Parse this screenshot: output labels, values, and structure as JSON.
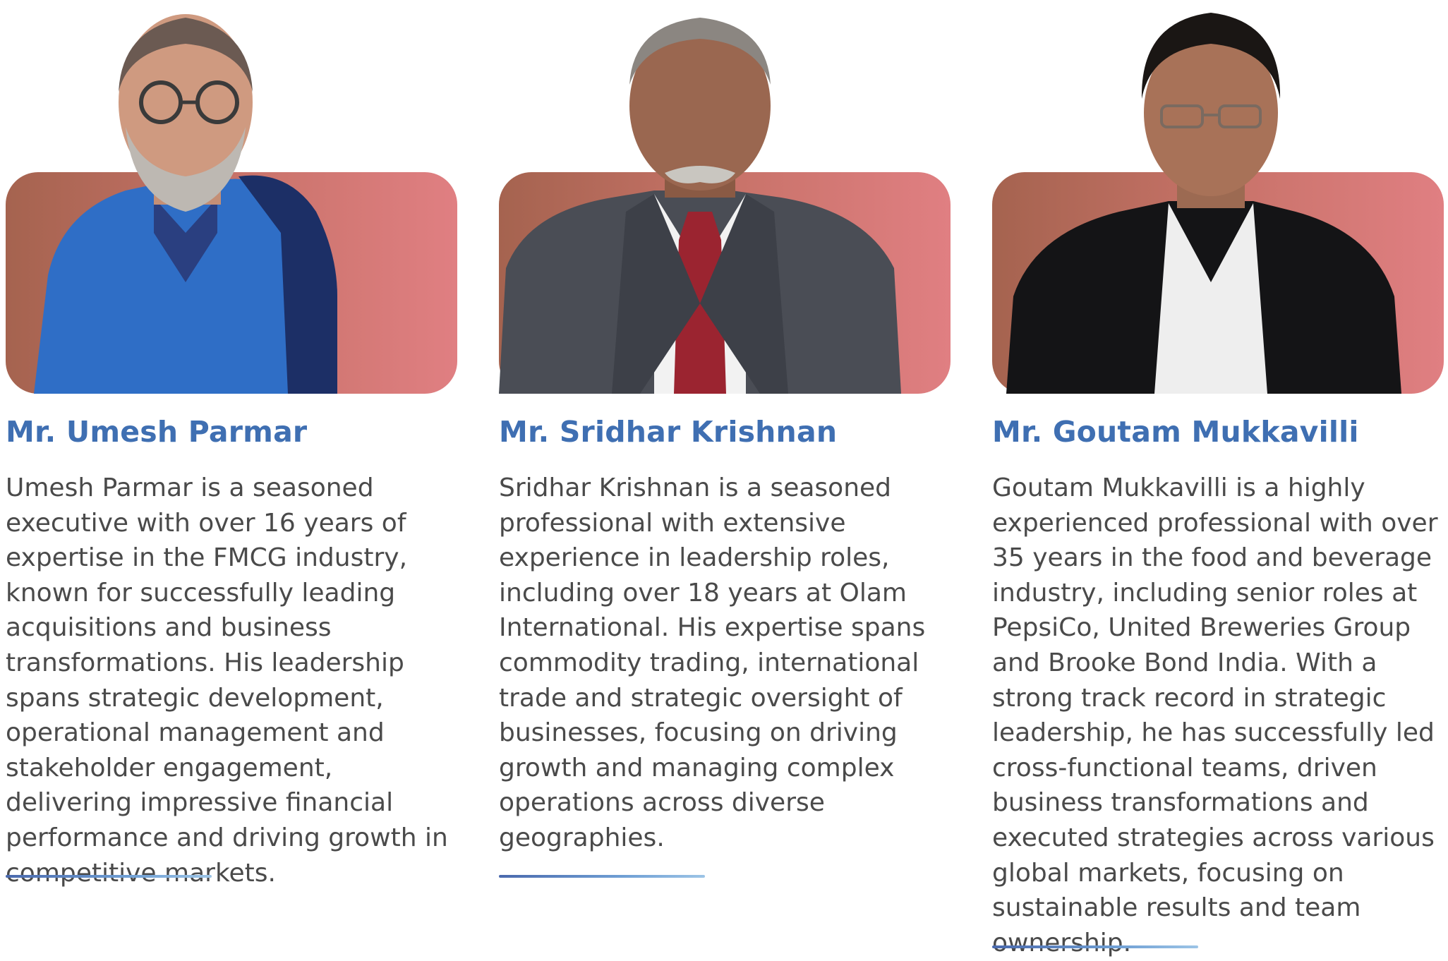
{
  "people": [
    {
      "name": "Mr. Umesh Parmar",
      "bio": "Umesh Parmar is a seasoned executive with over 16 years of expertise in the FMCG industry, known for successfully leading acquisitions and business transformations. His leadership spans strategic development, operational management and stakeholder engagement, delivering impressive financial performance and driving growth in competitive markets."
    },
    {
      "name": "Mr. Sridhar Krishnan",
      "bio": "Sridhar Krishnan is a seasoned professional with extensive experience in leadership roles, including over 18 years at Olam International. His expertise spans commodity trading, international trade and strategic oversight of businesses, focusing on driving growth and managing complex operations across diverse geographies."
    },
    {
      "name": "Mr. Goutam Mukkavilli",
      "bio": "Goutam Mukkavilli is a highly experienced professional with over 35 years in the food and beverage industry, including senior roles at PepsiCo, United Breweries Group and Brooke Bond India. With a strong track record in strategic leadership, he has successfully led cross-functional teams, driven business transformations and executed strategies across various global markets, focusing on sustainable results and team ownership."
    }
  ],
  "colors": {
    "name": "#3f6fb2",
    "body_text": "#4a4a4a",
    "photo_gradient_start": "#a5634f",
    "photo_gradient_end": "#e07f82",
    "rule_start": "#4a69ad",
    "rule_end": "#9cc4e6"
  }
}
